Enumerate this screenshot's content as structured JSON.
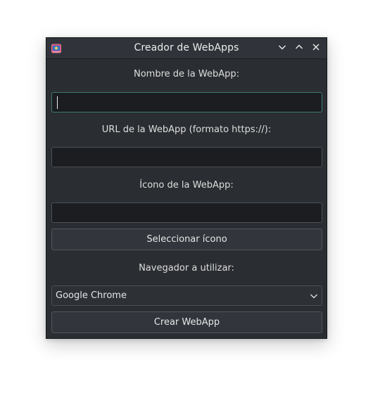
{
  "window": {
    "title": "Creador de WebApps",
    "app_icon": "webapp-icon",
    "controls": [
      "minimize",
      "maximize",
      "close"
    ]
  },
  "form": {
    "name_label": "Nombre de la WebApp:",
    "name_value": "",
    "url_label": "URL de la WebApp (formato https://):",
    "url_value": "",
    "icon_label": "Ícono de la WebApp:",
    "icon_value": "",
    "select_icon_button": "Seleccionar ícono",
    "browser_label": "Navegador a utilizar:",
    "browser_selected": "Google Chrome",
    "create_button": "Crear WebApp"
  },
  "colors": {
    "window_bg": "#2a2d31",
    "titlebar_bg": "#30343a",
    "field_bg": "#1b1d21",
    "focus_border": "#3e7b75"
  }
}
